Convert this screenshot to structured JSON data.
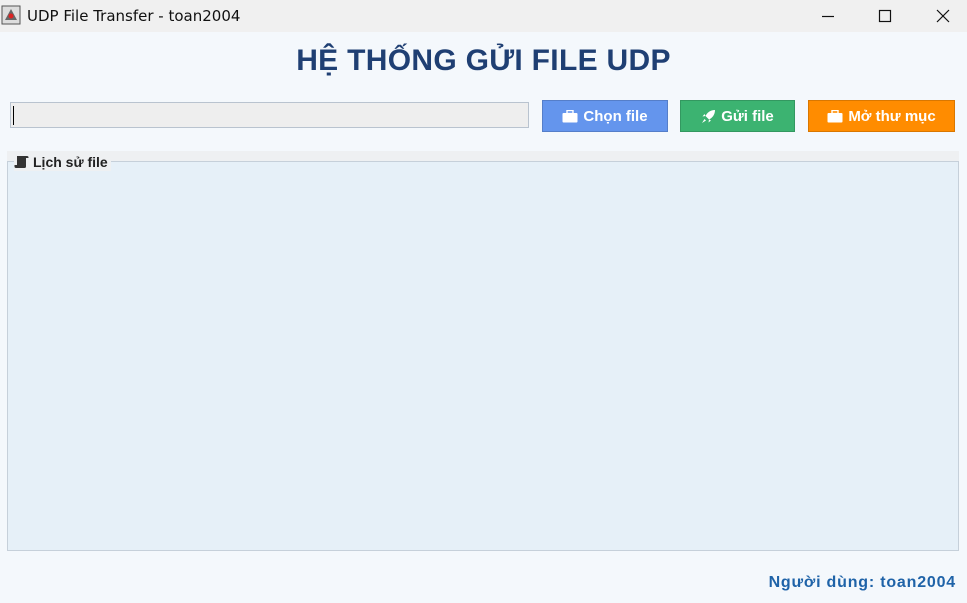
{
  "window": {
    "title": "UDP File Transfer - toan2004",
    "icon": "java-app-icon",
    "controls": [
      "minimize-icon",
      "maximize-icon",
      "close-icon"
    ]
  },
  "header": {
    "title": "HỆ THỐNG GỬI FILE UDP",
    "color": "#1f3f73"
  },
  "file_path": {
    "value": "",
    "placeholder": ""
  },
  "toolbar": {
    "choose_label": "Chọn file",
    "choose_icon": "briefcase-icon",
    "choose_color": "#6495ed",
    "send_label": "Gửi file",
    "send_icon": "rocket-icon",
    "send_color": "#3cb371",
    "open_label": "Mở thư mục",
    "open_icon": "briefcase-icon",
    "open_color": "#ff8c00"
  },
  "history": {
    "title": "Lịch sử file",
    "icon": "scroll-icon",
    "items": []
  },
  "footer": {
    "user_text": "Người dùng: toan2004"
  }
}
